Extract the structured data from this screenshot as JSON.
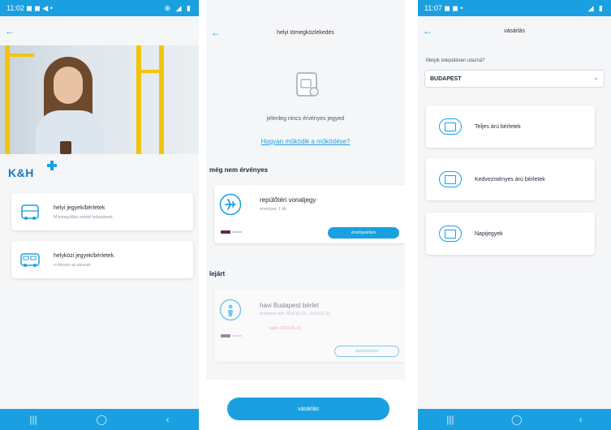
{
  "statusbar": {
    "left": [
      "11:02 ◼ ◼ ◀ •",
      "11:07 ◼ ◼ •"
    ],
    "right": [
      "⊕ ◢ ▮",
      "◢ ▮"
    ]
  },
  "navbar": {
    "recent": "|||",
    "home": "◯",
    "back": "‹"
  },
  "screen1": {
    "brand": "K&H",
    "cards": [
      {
        "title": "helyi jegyek/bérletek",
        "subtitle": "M betegvillási vsértél kelyaiásrok"
      },
      {
        "title": "helyközi jegyek/bérletek",
        "subtitle": "e-hévorin az aloszek"
      }
    ]
  },
  "screen2": {
    "title": "helyi tömegközlekedés",
    "empty_text": "jelenleg nincs érvényes jegyed",
    "how_link": "Hogyan működik a működése?",
    "section_not_valid": "még nem érvényes",
    "ticket1": {
      "title": "repülőtéri vonaljegy",
      "sub": "érvényes: 1 db",
      "button": "érvényesítem"
    },
    "section_expired": "lejárt",
    "ticket2": {
      "title": "havi Budapest bérlet",
      "sub": "érvényes volt: 2019.01.01 - 2019.01.31",
      "tag": "lejárt: 2019.01.31",
      "button": "újravásárlom"
    },
    "buy_button": "vásárlás"
  },
  "screen3": {
    "title": "vásárlás",
    "city_label": "Melyik településen utazná?",
    "city_value": "BUDAPEST",
    "options": [
      "Teljes árú bérletek",
      "Kedvezményes árú bérletek",
      "Napijegyek"
    ]
  },
  "colors": {
    "accent": "#1aa0e0",
    "brand": "#1577c4"
  }
}
